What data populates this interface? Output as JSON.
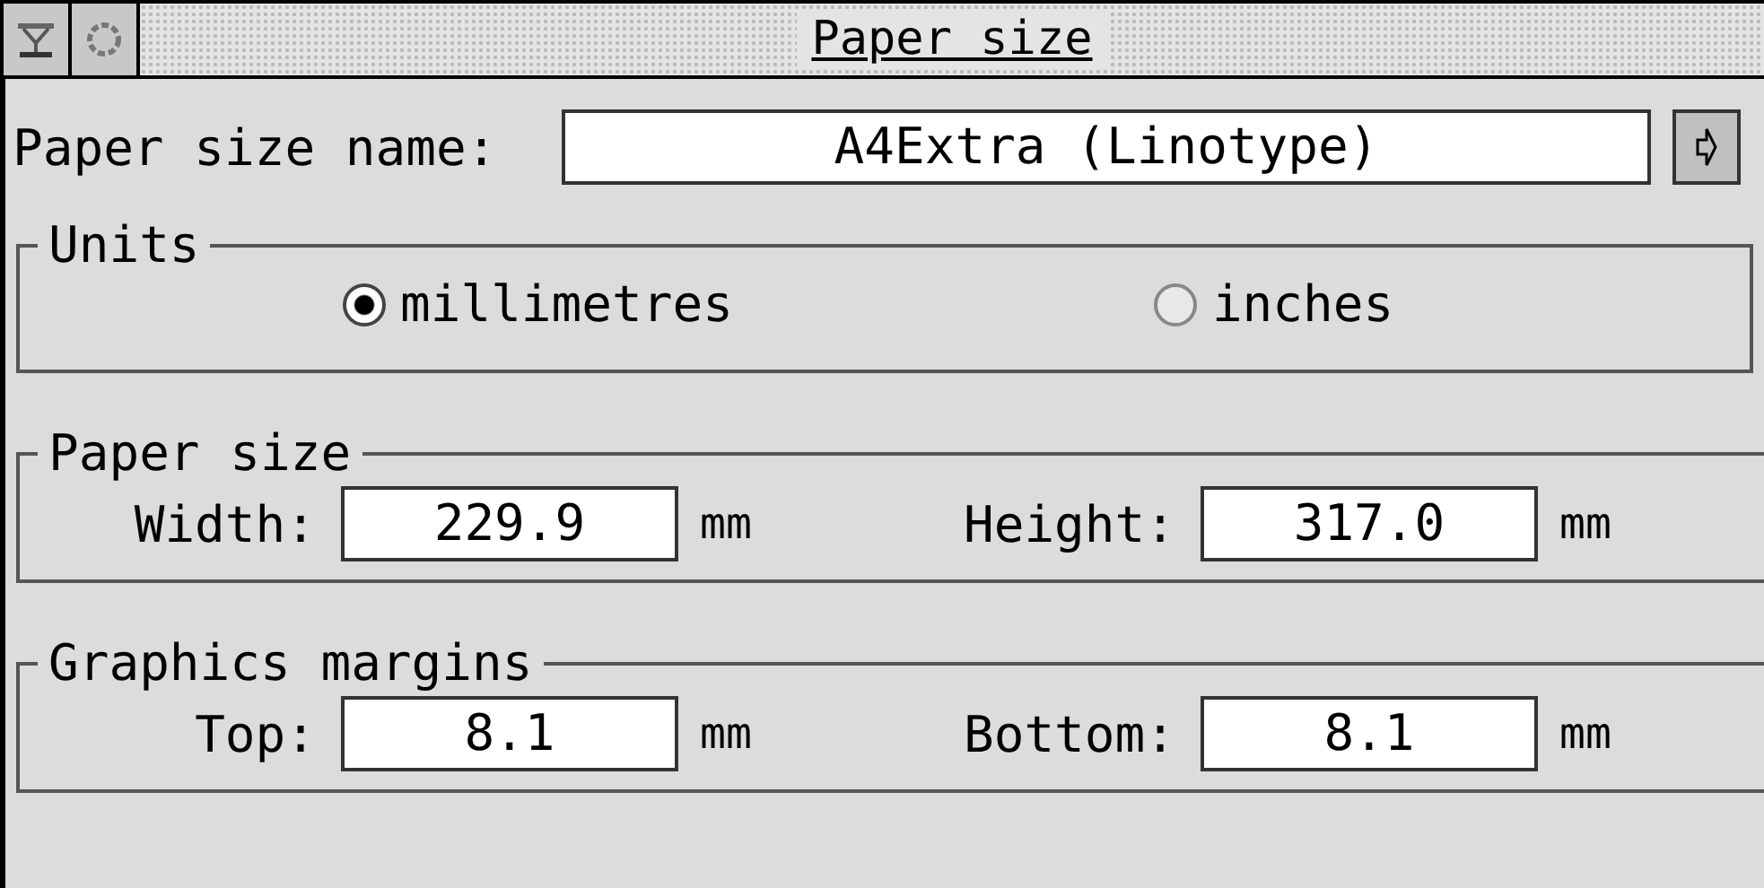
{
  "window": {
    "title": "Paper size"
  },
  "paper_size_name": {
    "label": "Paper size name:",
    "value": "A4Extra (Linotype)"
  },
  "units": {
    "title": "Units",
    "options": [
      {
        "label": "millimetres",
        "selected": true
      },
      {
        "label": "inches",
        "selected": false
      }
    ]
  },
  "paper_size": {
    "title": "Paper size",
    "fields": [
      {
        "label": "Width:",
        "value": "229.9",
        "unit": "mm"
      },
      {
        "label": "Height:",
        "value": "317.0",
        "unit": "mm"
      }
    ]
  },
  "graphics_margins": {
    "title": "Graphics margins",
    "fields": [
      {
        "label": "Top:",
        "value": "8.1",
        "unit": "mm"
      },
      {
        "label": "Bottom:",
        "value": "8.1",
        "unit": "mm"
      }
    ]
  }
}
